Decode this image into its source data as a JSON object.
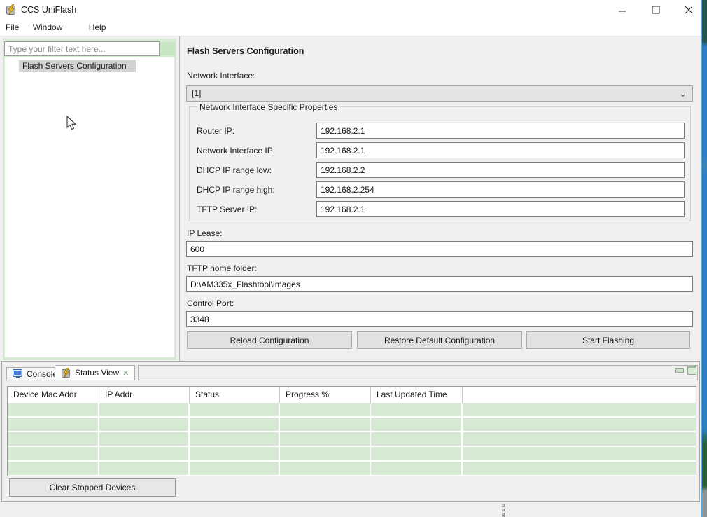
{
  "window": {
    "title": "CCS UniFlash"
  },
  "menu": {
    "items": [
      {
        "label": "File"
      },
      {
        "label": "Window"
      },
      {
        "label": "Help"
      }
    ]
  },
  "sidebar": {
    "filter_placeholder": "Type your filter text here...",
    "tree_items": [
      {
        "label": "Flash Servers Configuration",
        "selected": true
      }
    ]
  },
  "config": {
    "title": "Flash Servers Configuration",
    "network_interface_label": "Network Interface:",
    "network_interface_value": "[1]",
    "group_title": "Network Interface Specific Properties",
    "group_fields": [
      {
        "label": "Router IP:",
        "value": "192.168.2.1"
      },
      {
        "label": "Network Interface IP:",
        "value": "192.168.2.1"
      },
      {
        "label": "DHCP IP range low:",
        "value": "192.168.2.2"
      },
      {
        "label": "DHCP IP range high:",
        "value": "192.168.2.254"
      },
      {
        "label": "TFTP Server IP:",
        "value": "192.168.2.1"
      }
    ],
    "bottom_fields": [
      {
        "label": "IP Lease:",
        "value": "600"
      },
      {
        "label": "TFTP home folder:",
        "value": "D:\\AM335x_Flashtool\\images"
      },
      {
        "label": "Control Port:",
        "value": "3348"
      }
    ],
    "buttons": [
      {
        "label": "Reload Configuration"
      },
      {
        "label": "Restore Default Configuration"
      },
      {
        "label": "Start Flashing"
      }
    ]
  },
  "panel": {
    "tabs": [
      {
        "label": "Console",
        "icon": "console-monitor-icon",
        "active": false
      },
      {
        "label": "Status View",
        "icon": "flash-bolt-icon",
        "active": true,
        "closable": true
      }
    ],
    "table": {
      "columns": [
        "Device Mac Addr",
        "IP Addr",
        "Status",
        "Progress %",
        "Last Updated Time"
      ],
      "rows": [],
      "empty_row_count": 5
    },
    "clear_button_label": "Clear Stopped Devices"
  },
  "glyphs": {
    "close_x": "✕",
    "chevron_down": "⌄"
  },
  "colors": {
    "row_green": "#d6e9d3",
    "sidebar_green": "#d7ebd4",
    "desktop_blue": "#2d7fc2",
    "tree_selection": "#d2d2d2"
  }
}
